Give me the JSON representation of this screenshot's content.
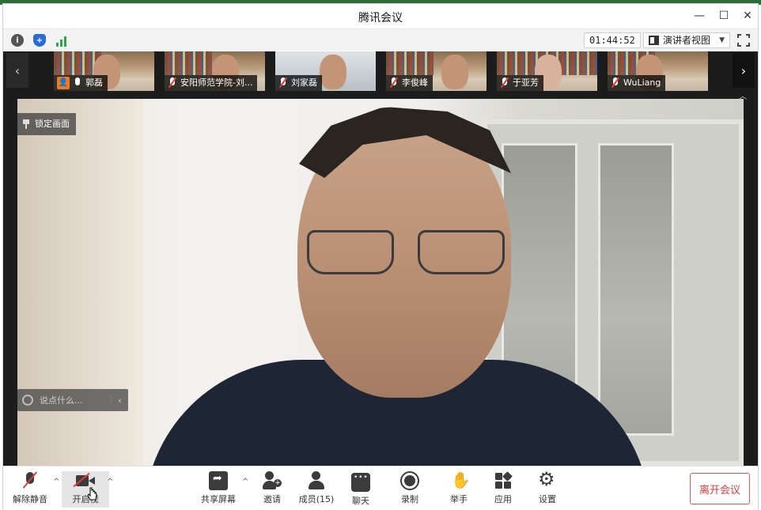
{
  "window": {
    "title": "腾讯会议",
    "controls": {
      "minimize": "—",
      "maximize": "☐",
      "close": "✕"
    }
  },
  "infobar": {
    "icons": [
      "info-icon",
      "shield-icon",
      "signal-icon"
    ],
    "timer": "01:44:52",
    "view_mode": "演讲者视图",
    "view_mode_caret": "▼"
  },
  "filmstrip": {
    "prev": "‹",
    "next": "›",
    "collapse": "︿",
    "participants": [
      {
        "name": "郭磊",
        "host": true,
        "muted": false
      },
      {
        "name": "安阳师范学院-刘...",
        "host": false,
        "muted": true
      },
      {
        "name": "刘家磊",
        "host": false,
        "muted": true
      },
      {
        "name": "李俊峰",
        "host": false,
        "muted": true
      },
      {
        "name": "于亚芳",
        "host": false,
        "muted": true
      },
      {
        "name": "WuLiang",
        "host": false,
        "muted": true
      }
    ]
  },
  "main_video": {
    "pin_label": "锁定画面",
    "chat_placeholder": "说点什么...",
    "chat_collapse": "‹"
  },
  "toolbar": {
    "unmute": "解除静音",
    "start_video": "开启视",
    "share_screen": "共享屏幕",
    "invite": "邀请",
    "members": "成员(15)",
    "chat": "聊天",
    "record": "录制",
    "raise_hand": "举手",
    "apps": "应用",
    "settings": "设置",
    "leave": "离开会议",
    "dropdown_arrow": "^"
  },
  "colors": {
    "accent_red": "#e03b3b",
    "host_orange": "#f07a1a",
    "shield_blue": "#2a6bd4",
    "signal_green": "#2aa84a"
  }
}
